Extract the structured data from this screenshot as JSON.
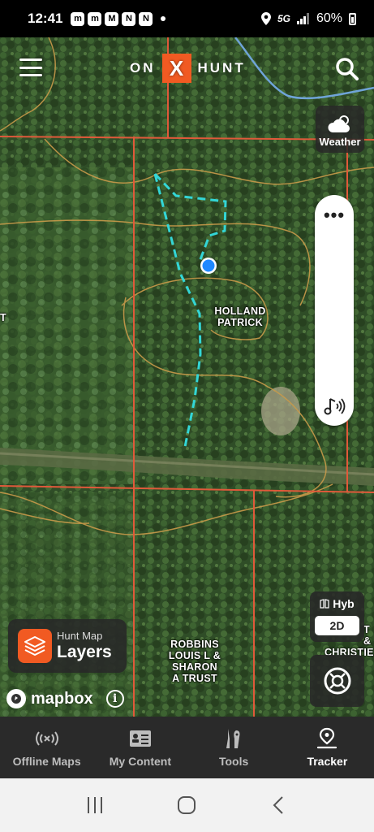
{
  "status_bar": {
    "time": "12:41",
    "network": "5G",
    "battery": "60%",
    "notification_icons": [
      "messenger-icon",
      "messenger-icon",
      "gmail-icon",
      "app-n-icon",
      "app-n-icon"
    ]
  },
  "header": {
    "logo_left": "ON",
    "logo_x": "X",
    "logo_right": "HUNT"
  },
  "map": {
    "parcel_labels": [
      {
        "lines": [
          "HOLLAND",
          "PATRICK"
        ]
      },
      {
        "lines": [
          "ROBBINS",
          "LOUIS L &",
          "SHARON",
          "A TRUST"
        ]
      },
      {
        "lines": [
          "T &",
          "CHRISTIE"
        ]
      },
      {
        "lines": [
          "T"
        ]
      }
    ],
    "colors": {
      "parcel_line": "#e0593a",
      "contour_line": "#c99a4a",
      "track_line": "#33d6d6",
      "location_dot": "#1e88ff",
      "river": "#6fa4d8"
    }
  },
  "controls": {
    "weather_label": "Weather",
    "pill_dots": "•••",
    "basemap_label": "Hyb",
    "view_mode": "2D",
    "layers_small": "Hunt Map",
    "layers_big": "Layers",
    "mapbox_label": "mapbox",
    "info_symbol": "i"
  },
  "tabs": [
    {
      "label": "Offline Maps",
      "icon": "offline-signal-icon",
      "active": false
    },
    {
      "label": "My Content",
      "icon": "content-card-icon",
      "active": false
    },
    {
      "label": "Tools",
      "icon": "tools-icon",
      "active": false
    },
    {
      "label": "Tracker",
      "icon": "tracker-pin-icon",
      "active": true
    }
  ],
  "android_nav": [
    "recents-icon",
    "home-icon",
    "back-icon"
  ]
}
